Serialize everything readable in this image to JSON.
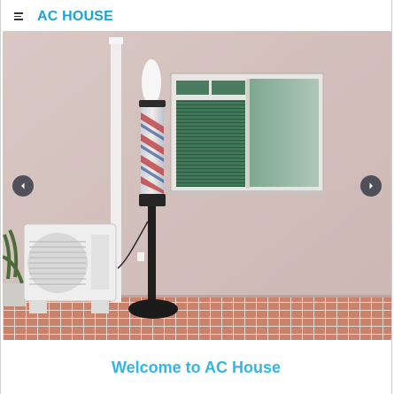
{
  "header": {
    "brand": "AC HOUSE",
    "menu_icon": "hamburger-menu-icon"
  },
  "carousel": {
    "prev_icon": "chevron-left-icon",
    "next_icon": "chevron-right-icon"
  },
  "main": {
    "welcome_text": "Welcome to AC House"
  },
  "colors": {
    "brand": "#1ba3d6",
    "welcome": "#35b4e6",
    "arrow_bg": "#373c46"
  }
}
